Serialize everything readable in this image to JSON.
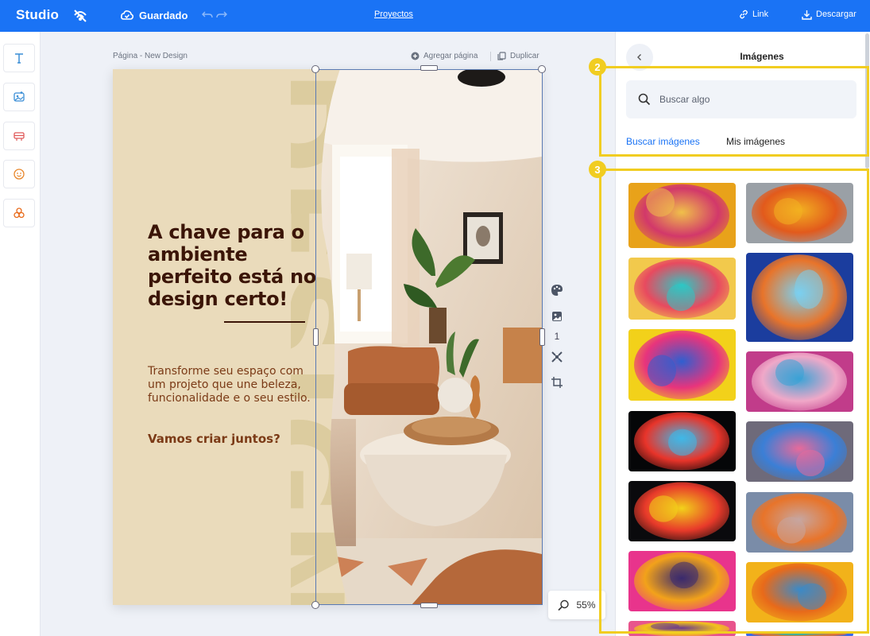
{
  "topbar": {
    "logo": "Studio",
    "saved_label": "Guardado",
    "projects_label": "Proyectos",
    "link_label": "Link",
    "download_label": "Descargar"
  },
  "left_tools": [
    "text-icon",
    "image-edit-icon",
    "template-icon",
    "emoji-icon",
    "shapes-icon"
  ],
  "canvas": {
    "page_label": "Página - New Design",
    "add_page_label": "Agregar página",
    "duplicate_label": "Duplicar",
    "page_number": "1",
    "zoom": "55%"
  },
  "design": {
    "headline": "A chave para o ambiente perfeito está no design certo!",
    "body": "Transforme seu espaço com um projeto que une beleza, funcionalidade e o seu estilo.",
    "cta": "Vamos criar juntos?",
    "watermark": "DESIGN",
    "background_color": "#eadbbb",
    "headline_color": "#3b1507",
    "body_color": "#7b3a16"
  },
  "panel": {
    "title": "Imágenes",
    "search_placeholder": "Buscar algo",
    "tabs": [
      {
        "label": "Buscar imágenes",
        "active": true
      },
      {
        "label": "Mis imágenes",
        "active": false
      }
    ],
    "annotations": [
      "2",
      "3"
    ],
    "images": [
      {
        "name": "colorful-hair-woman",
        "colors": [
          "#e8a21a",
          "#d2386a",
          "#f0c04a"
        ]
      },
      {
        "name": "color-explosion-splash",
        "colors": [
          "#9aa0a6",
          "#e25a1c",
          "#f2b021"
        ]
      },
      {
        "name": "rainbow-hair-girl",
        "colors": [
          "#f2c94c",
          "#e84a5f",
          "#2dc7c4"
        ]
      },
      {
        "name": "blue-painted-face",
        "colors": [
          "#1b3d9e",
          "#e8742a",
          "#7ad0f0"
        ]
      },
      {
        "name": "holi-hands-face",
        "colors": [
          "#f2d11a",
          "#e8347c",
          "#2f5fd0"
        ]
      },
      {
        "name": "powder-face-portrait",
        "colors": [
          "#c13c8a",
          "#f0a8c8",
          "#3aa3d6"
        ]
      },
      {
        "name": "paint-cups-splash",
        "colors": [
          "#050608",
          "#e8342a",
          "#3fb8e8"
        ]
      },
      {
        "name": "blue-powder-portrait",
        "colors": [
          "#6e6a7a",
          "#3b7fd6",
          "#e86a9a"
        ]
      },
      {
        "name": "dancer-color-wave",
        "colors": [
          "#0a0a0d",
          "#e83a2a",
          "#f2d21a"
        ]
      },
      {
        "name": "powder-burst",
        "colors": [
          "#7a8ca8",
          "#e8742a",
          "#c7a6a0"
        ]
      },
      {
        "name": "neon-hair-profile",
        "colors": [
          "#e8348c",
          "#f2a21a",
          "#3a2a6e"
        ]
      },
      {
        "name": "colorful-window-facade",
        "colors": [
          "#f2b21a",
          "#e86a1a",
          "#3a8ac8"
        ]
      },
      {
        "name": "partial-image-left",
        "colors": [
          "#e8548c",
          "#f2c21a",
          "#6a3a8e"
        ]
      },
      {
        "name": "partial-image-right",
        "colors": [
          "#3a6ae8",
          "#e8742a",
          "#2ab8a8"
        ]
      }
    ]
  }
}
